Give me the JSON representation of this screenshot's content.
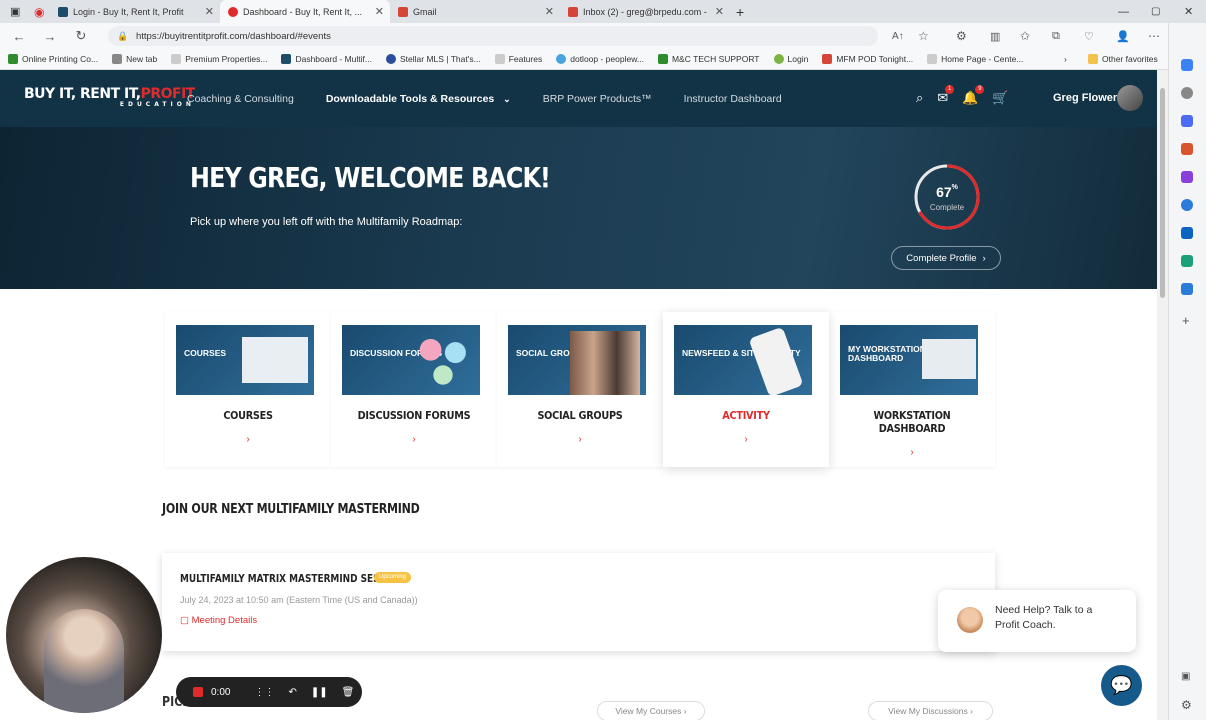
{
  "browser": {
    "tabs": [
      {
        "label": "Login - Buy It, Rent It, Profit",
        "active": false
      },
      {
        "label": "Dashboard - Buy It, Rent It, ...",
        "active": true
      },
      {
        "label": "Gmail",
        "active": false
      },
      {
        "label": "Inbox (2) - greg@brpedu.com -",
        "active": false
      }
    ],
    "url": "https://buyitrentitprofit.com/dashboard/#events",
    "bookmarks": [
      "Online Printing Co...",
      "New tab",
      "Premium Properties...",
      "Dashboard - Multif...",
      "Stellar MLS | That's...",
      "Features",
      "dotloop - peoplew...",
      "M&C TECH SUPPORT",
      "Login",
      "MFM POD Tonight...",
      "Home Page - Cente..."
    ],
    "other_favorites": "Other favorites"
  },
  "site": {
    "logo_line1": "BUY IT, RENT IT,",
    "logo_accent": "PROFIT",
    "logo_line2": "EDUCATION",
    "nav": [
      "Coaching & Consulting",
      "Downloadable Tools & Resources",
      "BRP Power Products™",
      "Instructor Dashboard"
    ],
    "badges": {
      "messages": "1",
      "notifications": "9"
    },
    "user_name": "Greg Flower"
  },
  "hero": {
    "title": "HEY GREG, WELCOME BACK!",
    "subtitle": "Pick up where you left off with the Multifamily Roadmap:",
    "progress_value": "67",
    "progress_unit": "%",
    "progress_fraction": 0.67,
    "progress_label": "Complete",
    "complete_profile": "Complete Profile",
    "accent": "#e02b2b"
  },
  "cards": [
    {
      "image_text": "COURSES",
      "title": "COURSES"
    },
    {
      "image_text": "DISCUSSION FORUMS",
      "title": "DISCUSSION FORUMS"
    },
    {
      "image_text": "SOCIAL GROUPS",
      "title": "SOCIAL GROUPS"
    },
    {
      "image_text": "NEWSFEED & SITE ACTIVITY",
      "title": "ACTIVITY"
    },
    {
      "image_text": "MY WORKSTATION DASHBOARD",
      "title": "WORKSTATION DASHBOARD"
    }
  ],
  "mastermind": {
    "section_title": "JOIN OUR NEXT MULTIFAMILY MASTERMIND",
    "event_title": "MULTIFAMILY MATRIX MASTERMIND SESSION",
    "event_badge": "Upcoming",
    "event_date": "July 24, 2023 at 10:50 am (Eastern Time (US and Canada))",
    "meeting_details": "Meeting Details"
  },
  "help": {
    "text": "Need Help? Talk to a Profit Coach."
  },
  "recorder": {
    "time": "0:00"
  },
  "bottom": {
    "section_title": "PICK UP WHERE YOU LEFT OFF",
    "view_courses": "View My Courses",
    "view_discussions": "View My Discussions"
  }
}
